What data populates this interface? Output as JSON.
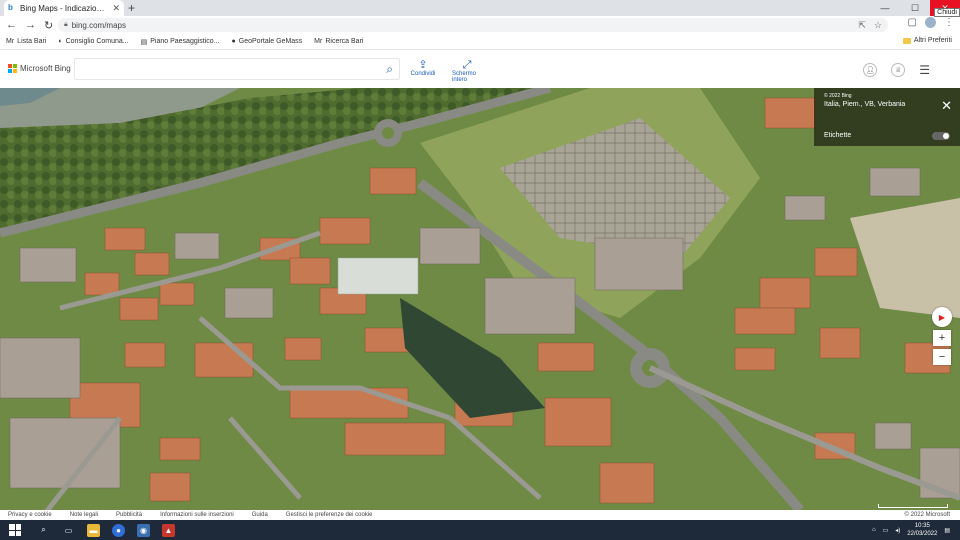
{
  "browser": {
    "tab_title": "Bing Maps - Indicazioni, pianif...",
    "tab_favicon": "b",
    "close_tooltip": "Chiudi",
    "url": "bing.com/maps",
    "bookmarks": [
      {
        "icon": "Mr",
        "label": "Lista Bari"
      },
      {
        "icon": "◐",
        "label": "Consiglio Comuna..."
      },
      {
        "icon": "▤",
        "label": "Piano Paesaggistico..."
      },
      {
        "icon": "●",
        "label": "GeoPortale GeMass"
      },
      {
        "icon": "Mr",
        "label": "Ricerca Bari"
      }
    ],
    "other_favorites": "Altri Preferiti"
  },
  "bing": {
    "logo_text": "Microsoft Bing",
    "search_placeholder": "",
    "actions": [
      {
        "icon": "share-icon",
        "label": "Condividi"
      },
      {
        "icon": "fullscreen-icon",
        "label": "Schermo intero"
      }
    ]
  },
  "map": {
    "copyright": "© 2022 Bing",
    "location": "Italia, Piem., VB, Verbania",
    "labels_toggle": "Etichette",
    "labels_on": false
  },
  "footer": {
    "links": [
      "Privacy e cookie",
      "Note legali",
      "Pubblicità",
      "Informazioni sulle inserzioni",
      "Guida",
      "Gestisci le preferenze dei cookie"
    ],
    "copyright": "© 2022 Microsoft"
  },
  "taskbar": {
    "time": "10:35",
    "date": "22/03/2022"
  },
  "colors": {
    "bing_blue": "#1a5bb8",
    "close_red": "#e81123",
    "taskbar": "#1e2a3a"
  }
}
